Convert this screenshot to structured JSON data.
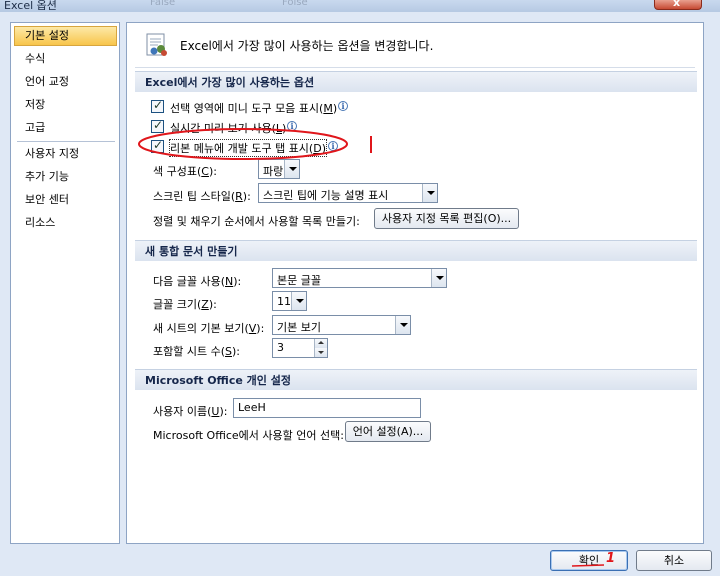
{
  "window": {
    "title": "Excel 옵션",
    "ghost_text_1": "False",
    "ghost_text_2": "Folse",
    "close_symbol": "x"
  },
  "sidebar": {
    "items": [
      {
        "label": "기본 설정",
        "selected": true
      },
      {
        "label": "수식"
      },
      {
        "label": "언어 교정"
      },
      {
        "label": "저장"
      },
      {
        "label": "고급"
      },
      {
        "label": "사용자 지정"
      },
      {
        "label": "추가 기능"
      },
      {
        "label": "보안 센터"
      },
      {
        "label": "리소스"
      }
    ]
  },
  "header": {
    "text": "Excel에서 가장 많이 사용하는 옵션을 변경합니다."
  },
  "section_popular": {
    "title": "Excel에서 가장 많이 사용하는 옵션",
    "checkbox_minitoolbar": {
      "label": "선택 영역에 미니 도구 모음 표시(",
      "key": "M",
      "suffix": ")",
      "checked": true
    },
    "checkbox_livepreview": {
      "label": "실시간 미리 보기 사용(",
      "key": "L",
      "suffix": ")",
      "checked": true
    },
    "checkbox_developer": {
      "label": "리본 메뉴에 개발 도구 탭 표시(",
      "key": "D",
      "suffix": ")",
      "checked": true
    },
    "color_scheme": {
      "label": "색 구성표(",
      "key": "C",
      "suffix": "):",
      "value": "파랑"
    },
    "screentip_style": {
      "label": "스크린 팁 스타일(",
      "key": "R",
      "suffix": "):",
      "value": "스크린 팁에 기능 설명 표시"
    },
    "custom_lists": {
      "label": "정렬 및 채우기 순서에서 사용할 목록 만들기:",
      "button": "사용자 지정 목록 편집(O)..."
    }
  },
  "section_new_workbook": {
    "title": "새 통합 문서 만들기",
    "font": {
      "label": "다음 글꼴 사용(",
      "key": "N",
      "suffix": "):",
      "value": "본문 글꼴"
    },
    "font_size": {
      "label": "글꼴 크기(",
      "key": "Z",
      "suffix": "):",
      "value": "11"
    },
    "default_view": {
      "label": "새 시트의 기본 보기(",
      "key": "V",
      "suffix": "):",
      "value": "기본 보기"
    },
    "sheet_count": {
      "label": "포함할 시트 수(",
      "key": "S",
      "suffix": "):",
      "value": "3"
    }
  },
  "section_personalize": {
    "title": "Microsoft Office 개인 설정",
    "user_name": {
      "label": "사용자 이름(",
      "key": "U",
      "suffix": "):",
      "value": "LeeH"
    },
    "language": {
      "label": "Microsoft Office에서 사용할 언어 선택:",
      "button": "언어 설정(A)..."
    }
  },
  "footer": {
    "ok": "확인",
    "cancel": "취소",
    "annotation_number": "1"
  },
  "colors": {
    "accent_selected": "#f8c54b",
    "annotation_red": "#e0161b",
    "panel_border": "#8ea4c4"
  }
}
